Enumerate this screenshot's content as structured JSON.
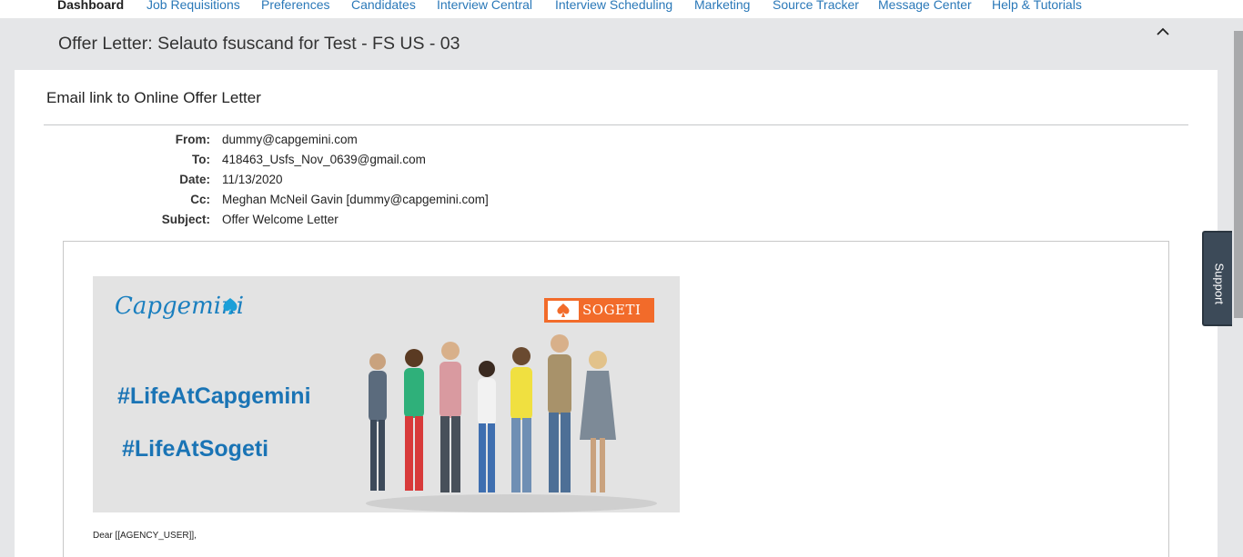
{
  "nav": {
    "items": [
      {
        "label": "Dashboard",
        "active": true
      },
      {
        "label": "Job Requisitions",
        "active": false
      },
      {
        "label": "Preferences",
        "active": false
      },
      {
        "label": "Candidates",
        "active": false
      },
      {
        "label": "Interview Central",
        "active": false
      },
      {
        "label": "Interview Scheduling",
        "active": false
      },
      {
        "label": "Marketing",
        "active": false
      },
      {
        "label": "Source Tracker",
        "active": false
      },
      {
        "label": "Message Center",
        "active": false
      },
      {
        "label": "Help & Tutorials",
        "active": false
      }
    ]
  },
  "header": {
    "title": "Offer Letter: Selauto fsuscand for Test - FS US - 03",
    "collapse_icon": "chevron-up-icon"
  },
  "section": {
    "title": "Email link to Online Offer Letter"
  },
  "email": {
    "from_label": "From:",
    "from": "dummy@capgemini.com",
    "to_label": "To:",
    "to": "418463_Usfs_Nov_0639@gmail.com",
    "date_label": "Date:",
    "date": "11/13/2020",
    "cc_label": "Cc:",
    "cc": "Meghan McNeil Gavin [dummy@capgemini.com]",
    "subject_label": "Subject:",
    "subject": "Offer Welcome Letter"
  },
  "letter": {
    "banner": {
      "logo_text": "Capgemini",
      "partner_text": "SOGETI",
      "hashtag_1": "#LifeAtCapgemini",
      "hashtag_2": "#LifeAtSogeti"
    },
    "salutation": "Dear [[AGENCY_USER]],"
  },
  "support": {
    "label": "Support"
  },
  "colors": {
    "link": "#2a78b8",
    "brand_blue": "#1a74b5",
    "sogeti_orange": "#f26b2a",
    "support_tab": "#3c4a58"
  }
}
